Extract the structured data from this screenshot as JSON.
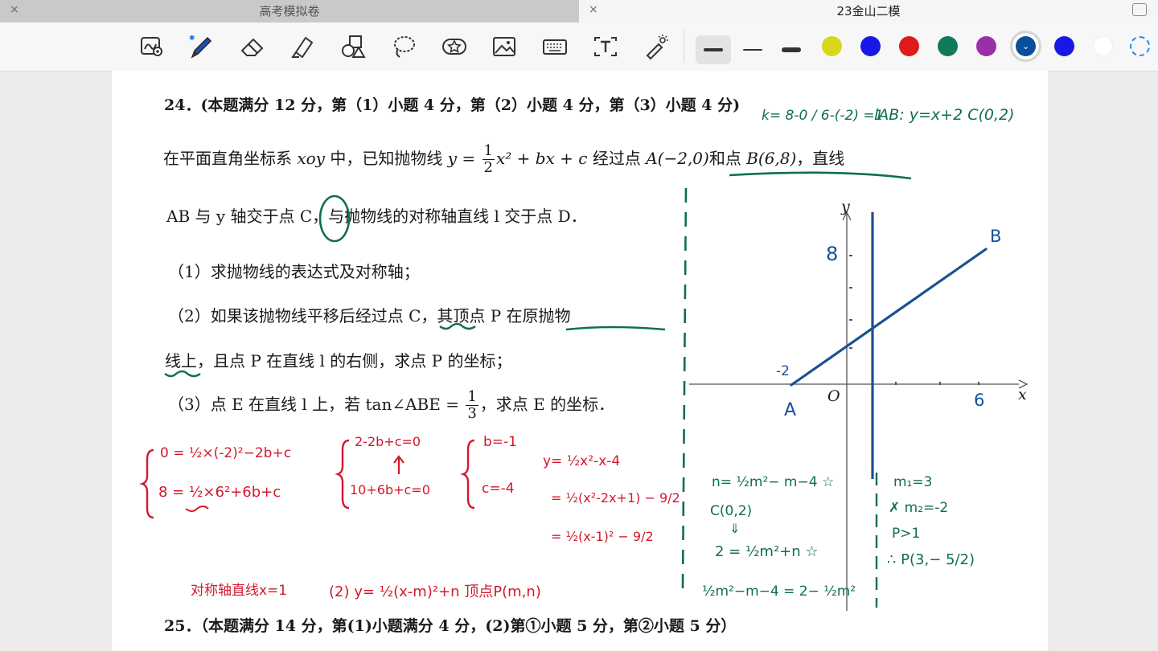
{
  "tabs": [
    {
      "title": "高考模拟卷",
      "close": "×"
    },
    {
      "title": "23金山二模",
      "close": "×"
    }
  ],
  "toolbar": {
    "tools": [
      "lasso-zoom-icon",
      "pen-icon",
      "eraser-icon",
      "highlighter-icon",
      "shapes-icon",
      "lasso-select-icon",
      "sticker-icon",
      "image-icon",
      "keyboard-icon",
      "text-box-icon",
      "laser-pointer-icon"
    ],
    "colors": [
      "#ffffff",
      "#d7d81c",
      "#1818e6",
      "#e01b1b",
      "#117a5b",
      "#9b2faa",
      "#0b4f9a",
      "#1818e6",
      "#ffffff"
    ],
    "selected_color": "#0b4f9a",
    "chevron": "⌄"
  },
  "doc": {
    "q24_header": "24．(本题满分 12 分，第（1）小题 4 分，第（2）小题 4 分，第（3）小题 4 分)",
    "line1_pre": "在平面直角坐标系 ",
    "line1_xoy": "xoy",
    "line1_mid": " 中，已知抛物线 ",
    "line1_y": "y",
    "eq": " = ",
    "half_num": "1",
    "half_den": "2",
    "line1_poly": "x² + bx + c",
    "line1_post": " 经过点 ",
    "pointA": "A(−2,0)",
    "and_point": "和点 ",
    "pointB": "B(6,8)",
    "line_word": "，直线",
    "line2": "AB 与 y 轴交于点 C，与抛物线的对称轴直线 l 交于点 D．",
    "item1": "（1）求抛物线的表达式及对称轴；",
    "item2a": "（2）如果该抛物线平移后经过点 C，其顶点 P 在原抛物",
    "item2b": "线上，且点 P 在直线 l 的右侧，求点 P 的坐标；",
    "item3_pre": "（3）点 E 在直线 l 上，若 tan∠ABE = ",
    "third_num": "1",
    "third_den": "3",
    "item3_post": "，求点 E 的坐标．",
    "q25_header": "25．（本题满分 14 分，第(1)小题满分 4 分，(2)第①小题 5 分，第②小题 5 分）",
    "axis_y": "y",
    "axis_x": "x",
    "origin": "O"
  },
  "handwriting": {
    "slope": "k= 8-0 / 6-(-2) =1",
    "lab": "lAB: y=x+2   C(0,2)",
    "g8": "8",
    "g2": "-2",
    "gB": "B",
    "gA": "A",
    "g6": "6",
    "sys1a": "0 = ½×(-2)²−2b+c",
    "sys1b": "8 = ½×6²+6b+c",
    "sys2a": "2-2b+c=0",
    "sys2b": "10+6b+c=0",
    "sol_b": "b=-1",
    "sol_c": "c=-4",
    "par1": "y= ½x²-x-4",
    "par2": "= ½(x²-2x+1) − 9/2",
    "par3": "= ½(x-1)² − 9/2",
    "axis_note": "对称轴直线x=1",
    "shift": "(2) y= ½(x-m)²+n   顶点P(m,n)",
    "g_n": "n= ½m²− m−4 ☆",
    "g_c": "C(0,2)",
    "g_arrow": "⇓",
    "g_sub": "2 = ½m²+n ☆",
    "g_eq": "½m²−m−4 = 2− ½m²",
    "r_m1": "m₁=3",
    "r_m2": "✗ m₂=-2",
    "r_p": "P>1",
    "r_res": "∴ P(3,− 5/2)"
  }
}
